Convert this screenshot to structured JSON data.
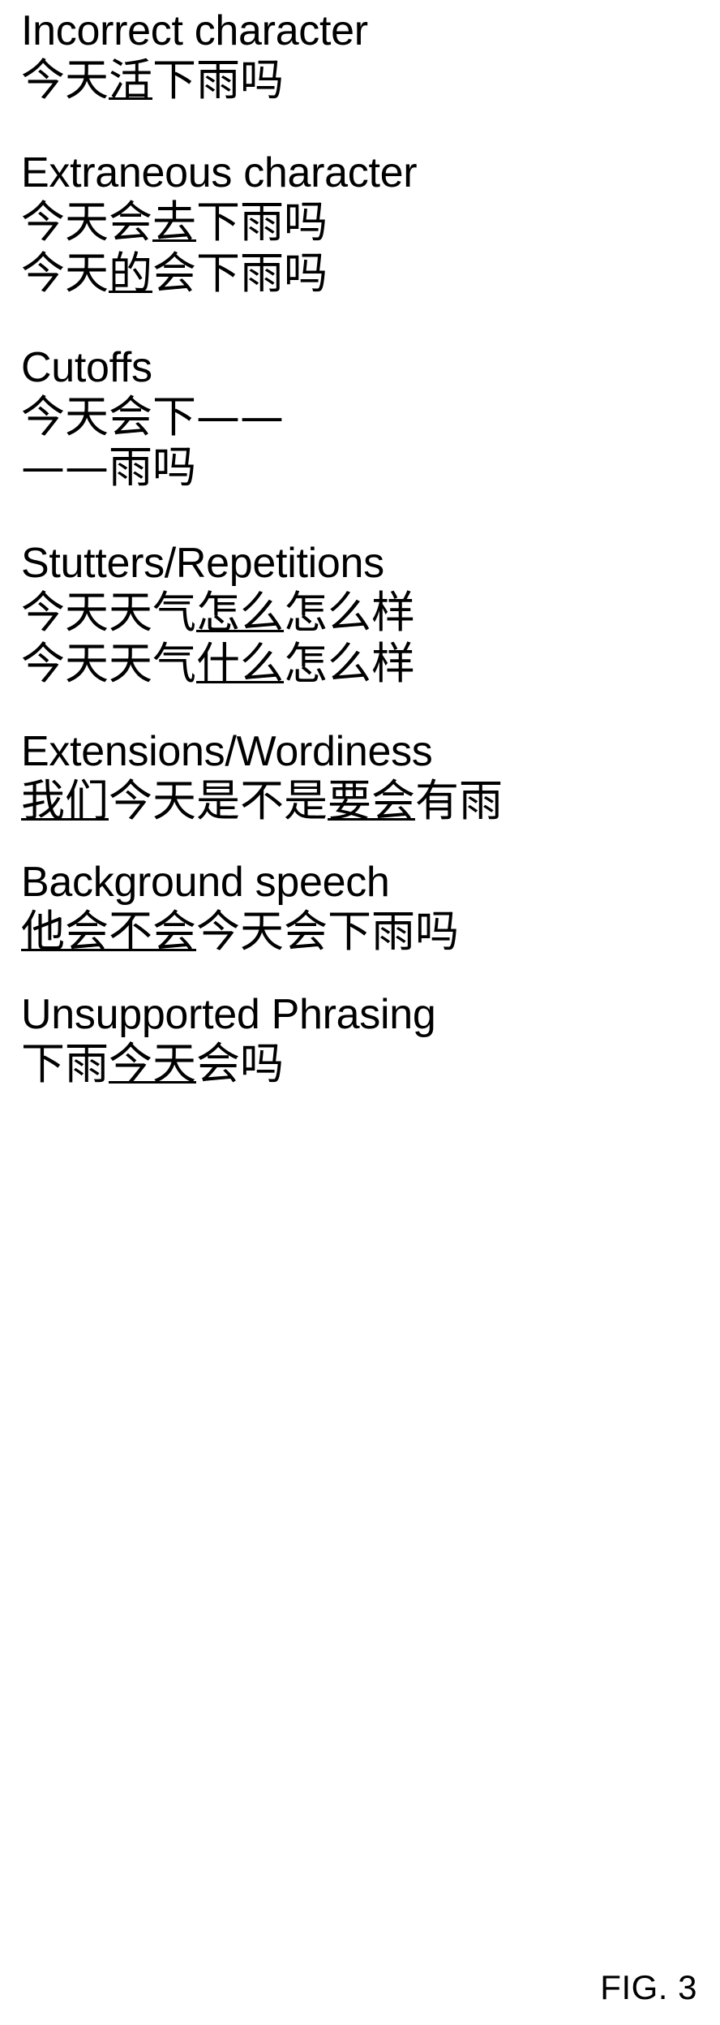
{
  "figure": {
    "label": "FIG. 3"
  },
  "sections": [
    {
      "heading": "Incorrect character",
      "lines": [
        {
          "pre": "今天",
          "underlined": "活",
          "post": "下雨吗"
        }
      ]
    },
    {
      "heading": "Extraneous character",
      "lines": [
        {
          "pre": "今天会",
          "underlined": "去",
          "post": "下雨吗"
        },
        {
          "pre": "今天",
          "underlined": "的",
          "post": "会下雨吗"
        }
      ]
    },
    {
      "heading": "Cutoffs",
      "lines": [
        {
          "pre": "今天会下——",
          "underlined": "",
          "post": ""
        },
        {
          "pre": "——雨吗",
          "underlined": "",
          "post": ""
        }
      ]
    },
    {
      "heading": "Stutters/Repetitions",
      "lines": [
        {
          "pre": "今天天气",
          "underlined": "怎么",
          "post": "怎么样"
        },
        {
          "pre": "今天天气",
          "underlined": "什么",
          "post": "怎么样"
        }
      ]
    },
    {
      "heading": "Extensions/Wordiness",
      "lines": [
        {
          "pre": "",
          "underlined": "我们",
          "post": "今天是不是",
          "underlined2": "要会",
          "post2": "有雨"
        }
      ]
    },
    {
      "heading": "Background speech",
      "lines": [
        {
          "pre": "",
          "underlined": "他会不会",
          "post": "今天会下雨吗"
        }
      ]
    },
    {
      "heading": "Unsupported Phrasing",
      "lines": [
        {
          "pre": "下雨",
          "underlined": "今天",
          "post": "会吗"
        }
      ]
    }
  ]
}
